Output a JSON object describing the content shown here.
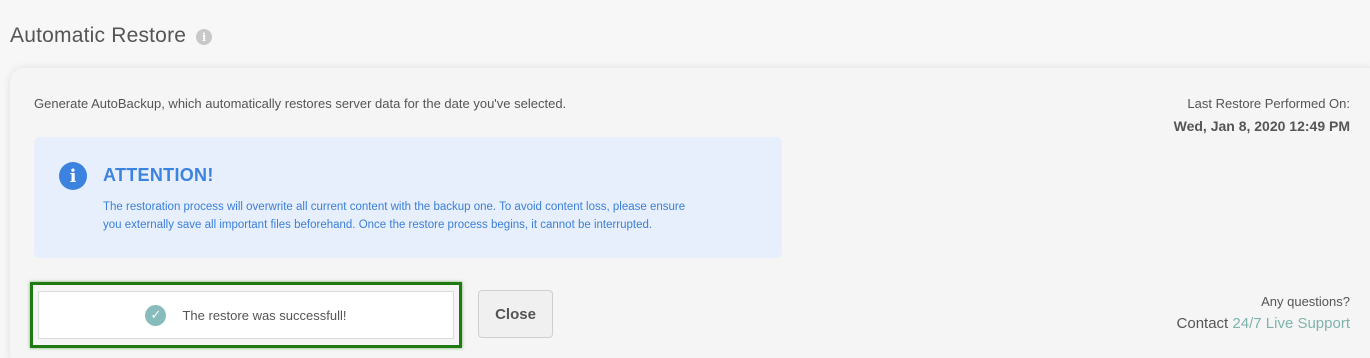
{
  "header": {
    "title": "Automatic Restore",
    "info_icon": "info-icon"
  },
  "description": "Generate AutoBackup, which automatically restores server data for the date you've selected.",
  "last_restore": {
    "label": "Last Restore Performed On:",
    "value": "Wed, Jan 8, 2020 12:49 PM"
  },
  "attention": {
    "icon": "info-icon",
    "heading": "ATTENTION!",
    "line1": "The restoration process will overwrite all current content with the backup one. To avoid content loss, please ensure",
    "line2": "you externally save all important files beforehand. Once the restore process begins, it cannot be interrupted."
  },
  "status": {
    "icon": "check-circle-icon",
    "message": "The restore was successfull!"
  },
  "close_label": "Close",
  "support": {
    "question": "Any questions?",
    "contact_prefix": "Contact",
    "link_text": "24/7 Live Support"
  },
  "colors": {
    "accent_blue": "#3c83e0",
    "attention_bg": "#e6effb",
    "success_check": "#88bcbc",
    "highlight_border": "#1f7a12",
    "support_link": "#7fb3ad"
  }
}
